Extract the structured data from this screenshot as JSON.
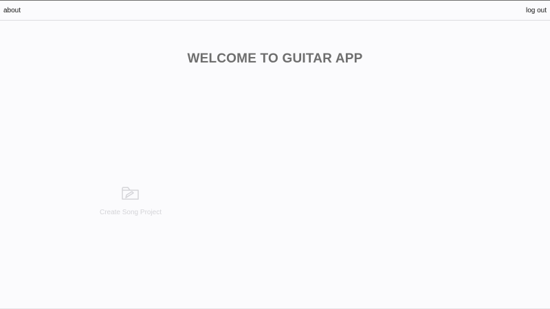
{
  "nav": {
    "about_label": "about",
    "logout_label": "log out"
  },
  "main": {
    "title": "WELCOME TO GUITAR APP",
    "create_tile": {
      "label": "Create Song Project",
      "icon": "folder-edit-icon"
    }
  },
  "colors": {
    "background": "#fbfbfd",
    "title": "#6e6e6e",
    "muted": "#d4d4d8"
  }
}
